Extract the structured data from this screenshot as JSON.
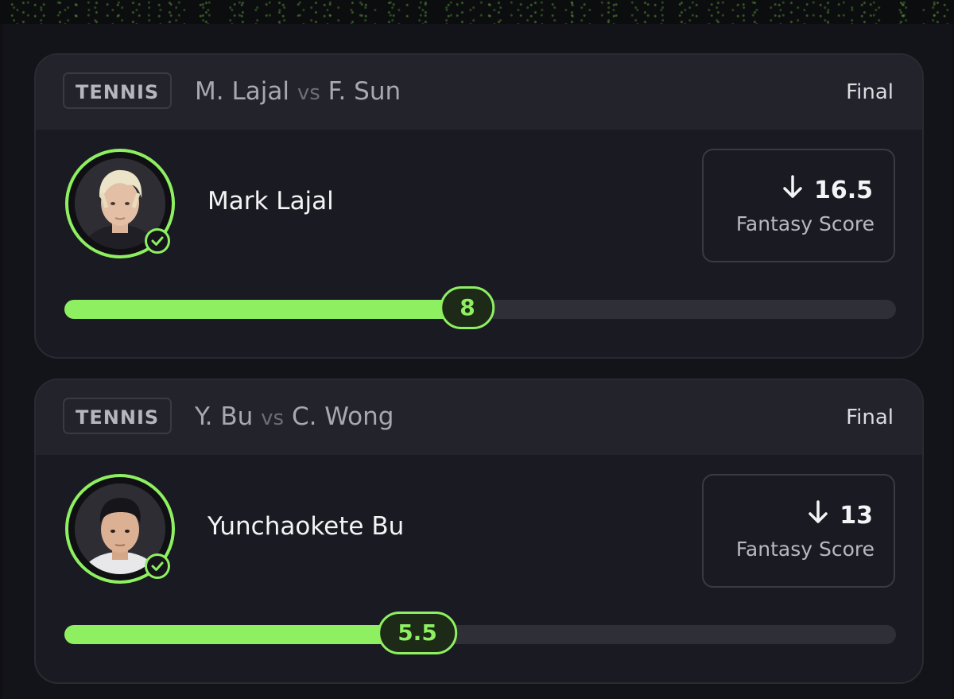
{
  "colors": {
    "accent": "#8ef060",
    "background": "#13131a",
    "card": "#1a1a22",
    "card_header": "#23232c"
  },
  "cards": [
    {
      "sport": "TENNIS",
      "player_a": "M. Lajal",
      "vs": "vs",
      "player_b": "F. Sun",
      "status": "Final",
      "player_name": "Mark Lajal",
      "avatar_icon": "player-photo",
      "verified_icon": "check-circle-icon",
      "direction_icon": "arrow-down-icon",
      "score": "16.5",
      "score_label": "Fantasy Score",
      "progress_value": "8",
      "progress_fraction": 0.485
    },
    {
      "sport": "TENNIS",
      "player_a": "Y. Bu",
      "vs": "vs",
      "player_b": "C. Wong",
      "status": "Final",
      "player_name": "Yunchaokete Bu",
      "avatar_icon": "player-photo",
      "verified_icon": "check-circle-icon",
      "direction_icon": "arrow-down-icon",
      "score": "13",
      "score_label": "Fantasy Score",
      "progress_value": "5.5",
      "progress_fraction": 0.424
    }
  ]
}
